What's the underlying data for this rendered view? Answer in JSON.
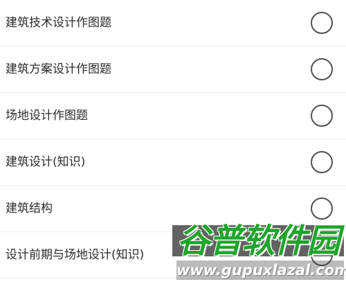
{
  "options": [
    {
      "label": "建筑技术设计作图题",
      "selected": false
    },
    {
      "label": "建筑方案设计作图题",
      "selected": false
    },
    {
      "label": "场地设计作图题",
      "selected": false
    },
    {
      "label": "建筑设计(知识)",
      "selected": false
    },
    {
      "label": "建筑结构",
      "selected": false
    },
    {
      "label": "设计前期与场地设计(知识)",
      "selected": false
    }
  ],
  "watermark": {
    "logo_text": "谷普软件园",
    "url_text": "www.gupuxlazal.com"
  },
  "colors": {
    "text": "#2a2a2a",
    "radio_border": "#505050",
    "divider": "#ececec",
    "watermark_green": "#1fa52b"
  }
}
